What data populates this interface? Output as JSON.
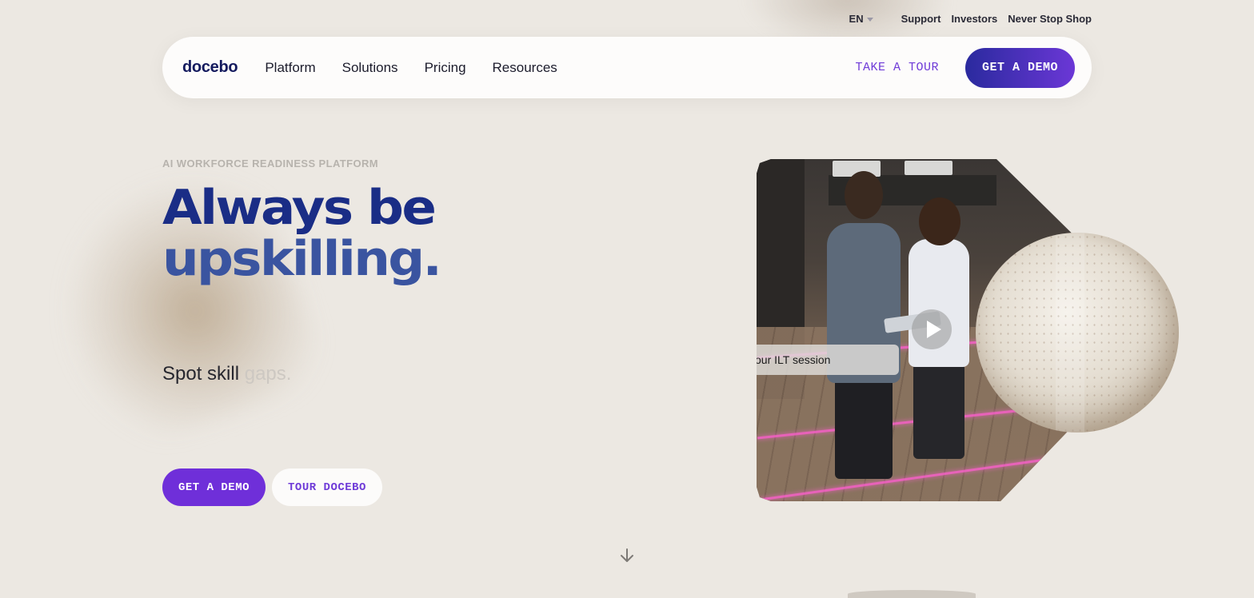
{
  "utility": {
    "language": "EN",
    "links": [
      "Support",
      "Investors",
      "Never Stop Shop"
    ]
  },
  "nav": {
    "logo": "docebo",
    "menu": [
      "Platform",
      "Solutions",
      "Pricing",
      "Resources"
    ],
    "take_tour": "TAKE A TOUR",
    "get_demo": "GET A DEMO"
  },
  "hero": {
    "eyebrow": "AI WORKFORCE READINESS PLATFORM",
    "headline_line1": "Always be",
    "headline_line2": "upskilling.",
    "rotator_solid": "Spot skill",
    "rotator_faded": "gaps.",
    "primary_cta": "GET A DEMO",
    "secondary_cta": "TOUR DOCEBO"
  },
  "media": {
    "caption": "our ILT session"
  },
  "colors": {
    "background": "#ece8e2",
    "brand_navy": "#1a2d86",
    "accent_purple": "#6f2fd9"
  },
  "icons": {
    "language_caret": "chevron-down-icon",
    "play": "play-icon",
    "scroll": "arrow-down-icon"
  }
}
